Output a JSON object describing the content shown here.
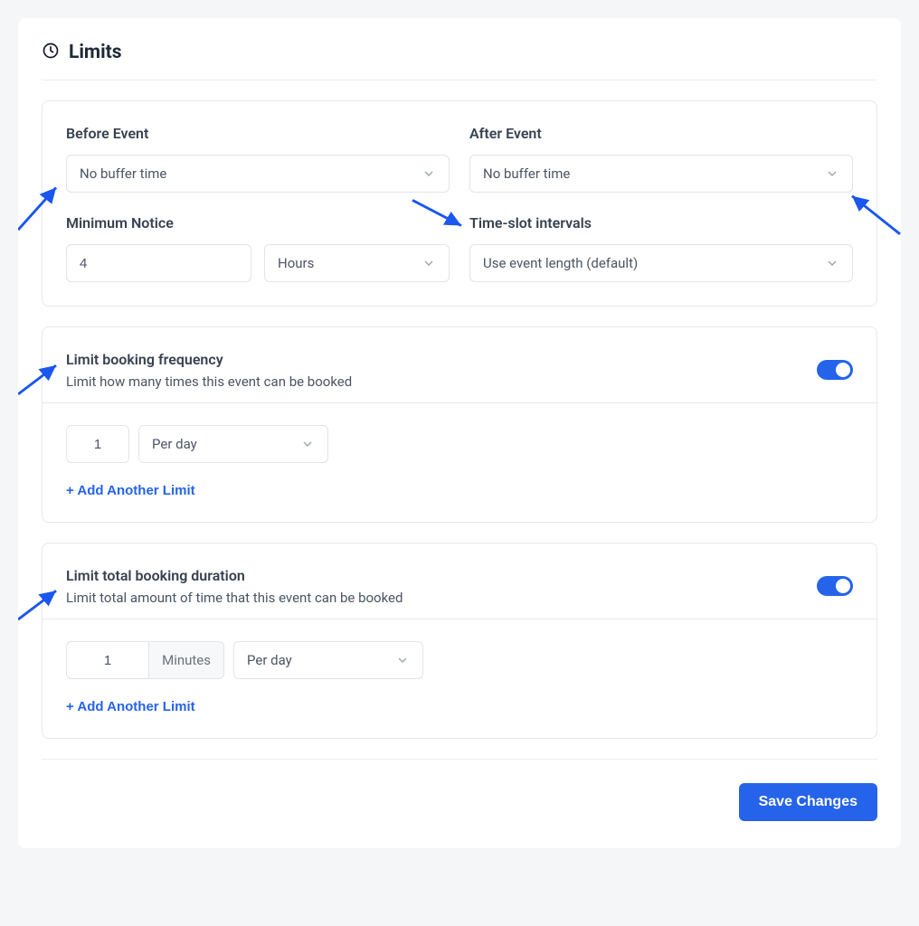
{
  "header": {
    "title": "Limits"
  },
  "buffer": {
    "before": {
      "label": "Before Event",
      "value": "No buffer time"
    },
    "after": {
      "label": "After Event",
      "value": "No buffer time"
    },
    "minNotice": {
      "label": "Minimum Notice",
      "value": "4",
      "unit": "Hours"
    },
    "interval": {
      "label": "Time-slot intervals",
      "value": "Use event length (default)"
    }
  },
  "freq": {
    "title": "Limit booking frequency",
    "desc": "Limit how many times this event can be booked",
    "value": "1",
    "period": "Per day",
    "addAnother": "+ Add Another Limit"
  },
  "dur": {
    "title": "Limit total booking duration",
    "desc": "Limit total amount of time that this event can be booked",
    "value": "1",
    "unit": "Minutes",
    "period": "Per day",
    "addAnother": "+ Add Another Limit"
  },
  "footer": {
    "save": "Save Changes"
  }
}
